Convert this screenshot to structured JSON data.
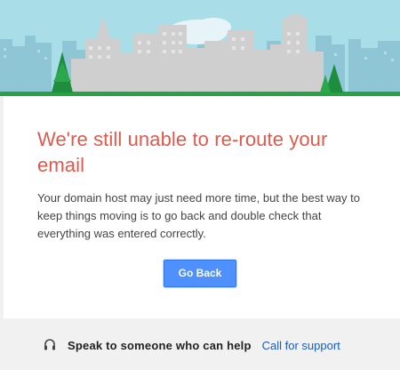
{
  "message": {
    "title": "We're still unable to re-route your email",
    "body": "Your domain host may just need more time, but the best way to keep things moving is to go back and double check that everything was entered correctly."
  },
  "actions": {
    "go_back_label": "Go Back"
  },
  "footer": {
    "speak_label": "Speak to someone who can help",
    "call_link_label": "Call for support",
    "icon": "headset-icon"
  },
  "colors": {
    "title": "#dd5a4d",
    "button": "#4d90fe",
    "link": "#1a5dbd",
    "sky": "#a9dde8",
    "grass": "#29a245",
    "tree": "#1e8e3e"
  }
}
